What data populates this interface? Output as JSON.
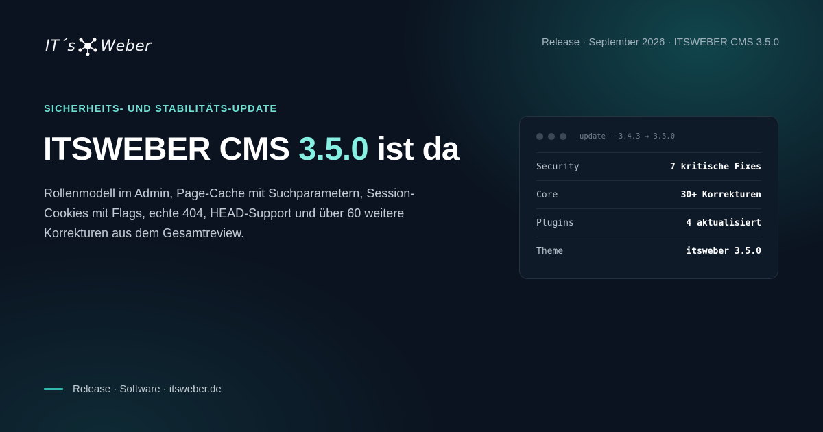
{
  "brand": {
    "logo_left": "IT´s",
    "logo_right": "Weber",
    "logo_icon": "molecule-icon",
    "accent_color": "#86f0e2"
  },
  "top_meta": "Release · September 2026 · ITSWEBER CMS 3.5.0",
  "kicker": "SICHERHEITS- UND STABILITÄTS-UPDATE",
  "headline": {
    "prefix": "ITSWEBER CMS",
    "version": "3.5.0",
    "suffix": "ist da"
  },
  "lead": "Rollenmodell im Admin, Page-Cache mit Suchparametern, Session-Cookies mit Flags, echte 404, HEAD-Support und über 60 weitere Korrekturen aus dem Gesamtreview.",
  "card": {
    "command": "update · 3.4.3 → 3.5.0",
    "rows": [
      {
        "key": "Security",
        "value": "7 kritische Fixes"
      },
      {
        "key": "Core",
        "value": "30+ Korrekturen"
      },
      {
        "key": "Plugins",
        "value": "4 aktualisiert"
      },
      {
        "key": "Theme",
        "value": "itsweber 3.5.0"
      }
    ]
  },
  "footer": "Release · Software · itsweber.de"
}
